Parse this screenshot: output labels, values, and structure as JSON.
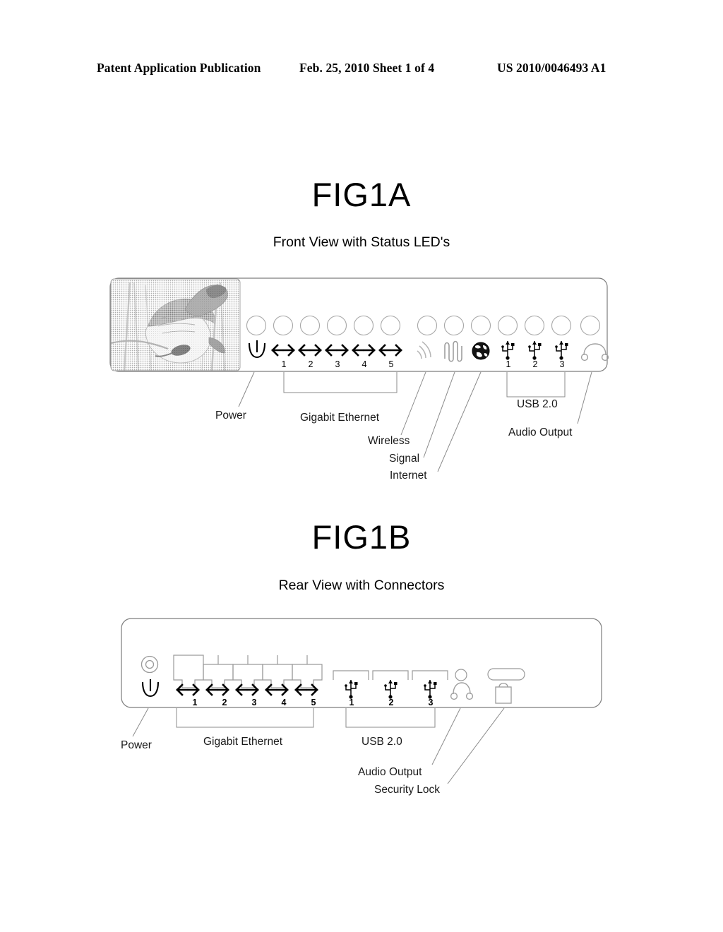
{
  "header": {
    "left": "Patent Application Publication",
    "middle": "Feb. 25, 2010  Sheet 1 of 4",
    "right": "US 2010/0046493 A1"
  },
  "figures": [
    {
      "id": "fig1a",
      "title": "FIG1A",
      "subtitle": "Front View with Status LED's",
      "panel": {
        "display_image": "duck-photo-halftone",
        "led_count": 13,
        "indicators": [
          {
            "icon": "power-icon",
            "label": "Power",
            "number": ""
          },
          {
            "icon": "ethernet-icon",
            "label": "Gigabit Ethernet",
            "number": "1"
          },
          {
            "icon": "ethernet-icon",
            "label": "Gigabit Ethernet",
            "number": "2"
          },
          {
            "icon": "ethernet-icon",
            "label": "Gigabit Ethernet",
            "number": "3"
          },
          {
            "icon": "ethernet-icon",
            "label": "Gigabit Ethernet",
            "number": "4"
          },
          {
            "icon": "ethernet-icon",
            "label": "Gigabit Ethernet",
            "number": "5"
          },
          {
            "icon": "wireless-icon",
            "label": "Wireless",
            "number": ""
          },
          {
            "icon": "signal-icon",
            "label": "Signal",
            "number": ""
          },
          {
            "icon": "globe-icon",
            "label": "Internet",
            "number": ""
          },
          {
            "icon": "usb-icon",
            "label": "USB 2.0",
            "number": "1"
          },
          {
            "icon": "usb-icon",
            "label": "USB 2.0",
            "number": "2"
          },
          {
            "icon": "usb-icon",
            "label": "USB 2.0",
            "number": "3"
          },
          {
            "icon": "headphone-icon",
            "label": "Audio Output",
            "number": ""
          }
        ]
      },
      "callouts": [
        {
          "text": "Power"
        },
        {
          "text": "Gigabit Ethernet"
        },
        {
          "text": "Wireless"
        },
        {
          "text": "Signal"
        },
        {
          "text": "Internet"
        },
        {
          "text": "USB 2.0"
        },
        {
          "text": "Audio Output"
        }
      ]
    },
    {
      "id": "fig1b",
      "title": "FIG1B",
      "subtitle": "Rear View with Connectors",
      "panel": {
        "connectors": [
          {
            "icon": "power-jack-icon",
            "label": "Power",
            "number": ""
          },
          {
            "icon": "rj45-port-icon",
            "label": "Gigabit Ethernet",
            "number": "1"
          },
          {
            "icon": "rj45-port-icon",
            "label": "Gigabit Ethernet",
            "number": "2"
          },
          {
            "icon": "rj45-port-icon",
            "label": "Gigabit Ethernet",
            "number": "3"
          },
          {
            "icon": "rj45-port-icon",
            "label": "Gigabit Ethernet",
            "number": "4"
          },
          {
            "icon": "rj45-port-icon",
            "label": "Gigabit Ethernet",
            "number": "5"
          },
          {
            "icon": "usb-port-icon",
            "label": "USB 2.0",
            "number": "1"
          },
          {
            "icon": "usb-port-icon",
            "label": "USB 2.0",
            "number": "2"
          },
          {
            "icon": "usb-port-icon",
            "label": "USB 2.0",
            "number": "3"
          },
          {
            "icon": "audio-jack-icon",
            "label": "Audio Output",
            "number": ""
          },
          {
            "icon": "security-slot-icon",
            "label": "Security Lock",
            "number": ""
          }
        ]
      },
      "callouts": [
        {
          "text": "Power"
        },
        {
          "text": "Gigabit Ethernet"
        },
        {
          "text": "USB 2.0"
        },
        {
          "text": "Audio Output"
        },
        {
          "text": "Security Lock"
        }
      ]
    }
  ],
  "numbers": {
    "ethernet": [
      "1",
      "2",
      "3",
      "4",
      "5"
    ],
    "usb": [
      "1",
      "2",
      "3"
    ]
  },
  "colors": {
    "ink": "#000000",
    "line": "#8a8a8a",
    "leader": "#6f6f6f",
    "panel_outline": "#6f6f6f"
  }
}
